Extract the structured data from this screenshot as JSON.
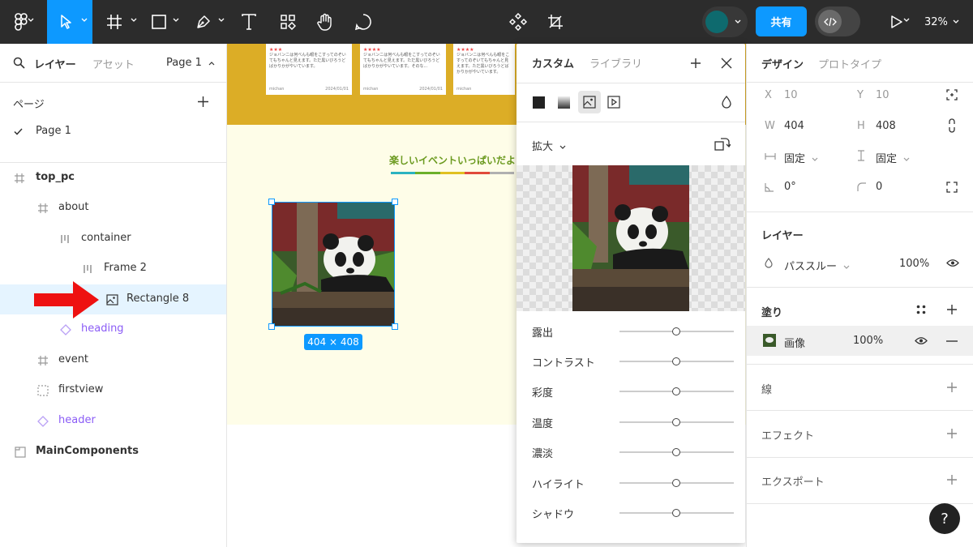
{
  "toolbar": {
    "share_label": "共有",
    "zoom_level": "32%"
  },
  "left_panel": {
    "tabs": {
      "layers": "レイヤー",
      "assets": "アセット"
    },
    "page_selector": "Page 1",
    "pages_heading": "ページ",
    "pages": [
      "Page 1"
    ],
    "layers": [
      {
        "name": "top_pc",
        "type": "frame",
        "depth": 0
      },
      {
        "name": "about",
        "type": "frame",
        "depth": 1
      },
      {
        "name": "container",
        "type": "autolayout",
        "depth": 2
      },
      {
        "name": "Frame 2",
        "type": "autolayout",
        "depth": 3
      },
      {
        "name": "Rectangle 8",
        "type": "image",
        "depth": 4,
        "selected": true
      },
      {
        "name": "heading",
        "type": "component",
        "depth": 2
      },
      {
        "name": "event",
        "type": "frame",
        "depth": 1
      },
      {
        "name": "firstview",
        "type": "section",
        "depth": 1
      },
      {
        "name": "header",
        "type": "component",
        "depth": 1
      },
      {
        "name": "MainComponents",
        "type": "section",
        "depth": 0
      }
    ]
  },
  "canvas": {
    "heading": "楽しいイベントいっぱいだよ",
    "selection_size": "404 × 408",
    "cards": [
      {
        "stars": "★★★",
        "text": "ジョバンニは何べんも眼をこすってのぞいてもちゃんと見えます。ただ黒いびろうどばかりかがやいています。",
        "user": "michan",
        "date": "2024/01/01"
      },
      {
        "stars": "★★★★",
        "text": "ジョバンニは何べんも眼をこすってのぞいてもちゃんと見えます。ただ黒いびろうどばかりかがやいています。そのな...",
        "user": "michan",
        "date": "2024/01/01"
      },
      {
        "stars": "★★★★",
        "text": "ジョバンニは何べんも眼をこすってのぞいてもちゃんと見えます。ただ黒いびろうどばかりかがやいています。",
        "user": "michan",
        "date": ""
      }
    ],
    "heading_line_colors": [
      "#2bb3c0",
      "#6bb02a",
      "#e0c020",
      "#e04a3a",
      "#b0b0b0"
    ]
  },
  "fill_popup": {
    "tabs": {
      "custom": "カスタム",
      "library": "ライブラリ"
    },
    "scale_mode": "拡大",
    "adjustments": [
      "露出",
      "コントラスト",
      "彩度",
      "温度",
      "濃淡",
      "ハイライト",
      "シャドウ"
    ]
  },
  "right_panel": {
    "tabs": {
      "design": "デザイン",
      "prototype": "プロトタイプ"
    },
    "x_label": "X",
    "x_value": "10",
    "y_label": "Y",
    "y_value": "10",
    "w_label": "W",
    "w_value": "404",
    "h_label": "H",
    "h_value": "408",
    "h_constraint": "固定",
    "v_constraint": "固定",
    "rotation": "0°",
    "radius": "0",
    "layer_title": "レイヤー",
    "blend_mode": "パススルー",
    "layer_opacity": "100%",
    "fill_title": "塗り",
    "fill_type": "画像",
    "fill_opacity": "100%",
    "stroke_title": "線",
    "effects_title": "エフェクト",
    "export_title": "エクスポート"
  },
  "help_label": "?",
  "colors": {
    "accent": "#0d99ff",
    "toolbar_bg": "#2c2c2c",
    "selected_row": "#e5f4ff",
    "arrow": "#ee1111"
  }
}
